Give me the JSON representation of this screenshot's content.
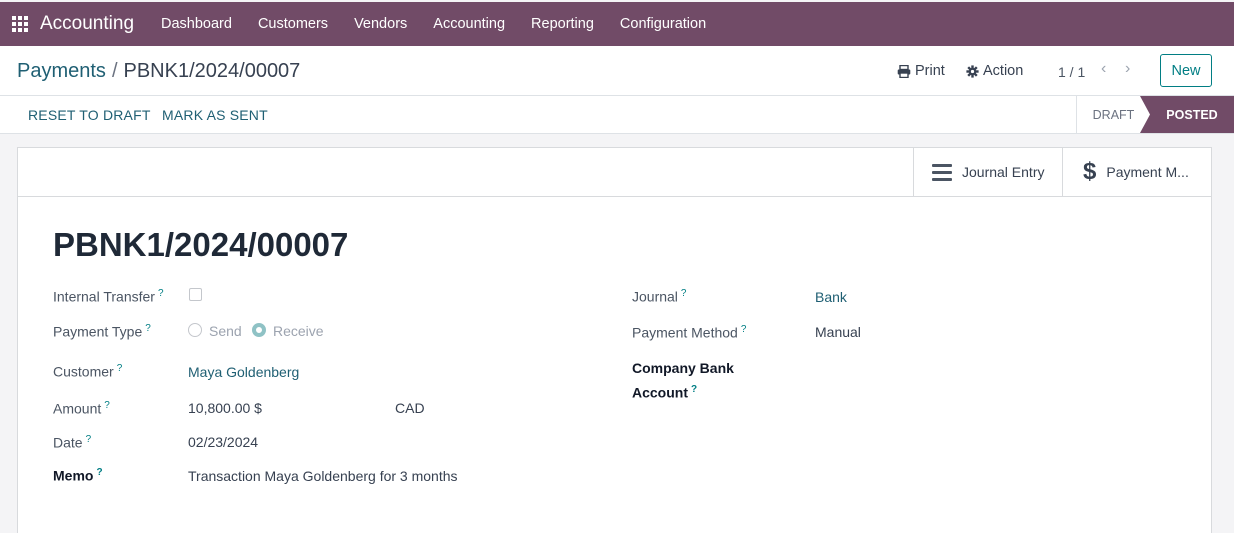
{
  "navbar": {
    "app_name": "Accounting",
    "menu": [
      "Dashboard",
      "Customers",
      "Vendors",
      "Accounting",
      "Reporting",
      "Configuration"
    ]
  },
  "breadcrumb": {
    "parent": "Payments",
    "separator": "/",
    "current": "PBNK1/2024/00007"
  },
  "control": {
    "print_label": "Print",
    "action_label": "Action",
    "pager": "1 / 1",
    "new_label": "New"
  },
  "statusbar": {
    "reset_label": "RESET TO DRAFT",
    "mark_sent_label": "MARK AS SENT",
    "stages": [
      "DRAFT",
      "POSTED"
    ],
    "active_stage": "POSTED"
  },
  "smart_buttons": {
    "journal_entry": "Journal Entry",
    "payment_matching": "Payment M..."
  },
  "form": {
    "title": "PBNK1/2024/00007",
    "internal_transfer_label": "Internal Transfer",
    "internal_transfer_checked": false,
    "payment_type_label": "Payment Type",
    "payment_type_options": [
      "Send",
      "Receive"
    ],
    "payment_type_selected": "Receive",
    "customer_label": "Customer",
    "customer_value": "Maya Goldenberg",
    "amount_label": "Amount",
    "amount_value": "10,800.00 $",
    "currency_value": "CAD",
    "date_label": "Date",
    "date_value": "02/23/2024",
    "memo_label": "Memo",
    "memo_value": "Transaction Maya Goldenberg for 3 months",
    "journal_label": "Journal",
    "journal_value": "Bank",
    "payment_method_label": "Payment Method",
    "payment_method_value": "Manual",
    "company_bank_label_1": "Company Bank",
    "company_bank_label_2": "Account",
    "help_mark": "?"
  },
  "colors": {
    "brand": "#714b67",
    "link": "#1f5f73",
    "accent": "#017e84"
  }
}
